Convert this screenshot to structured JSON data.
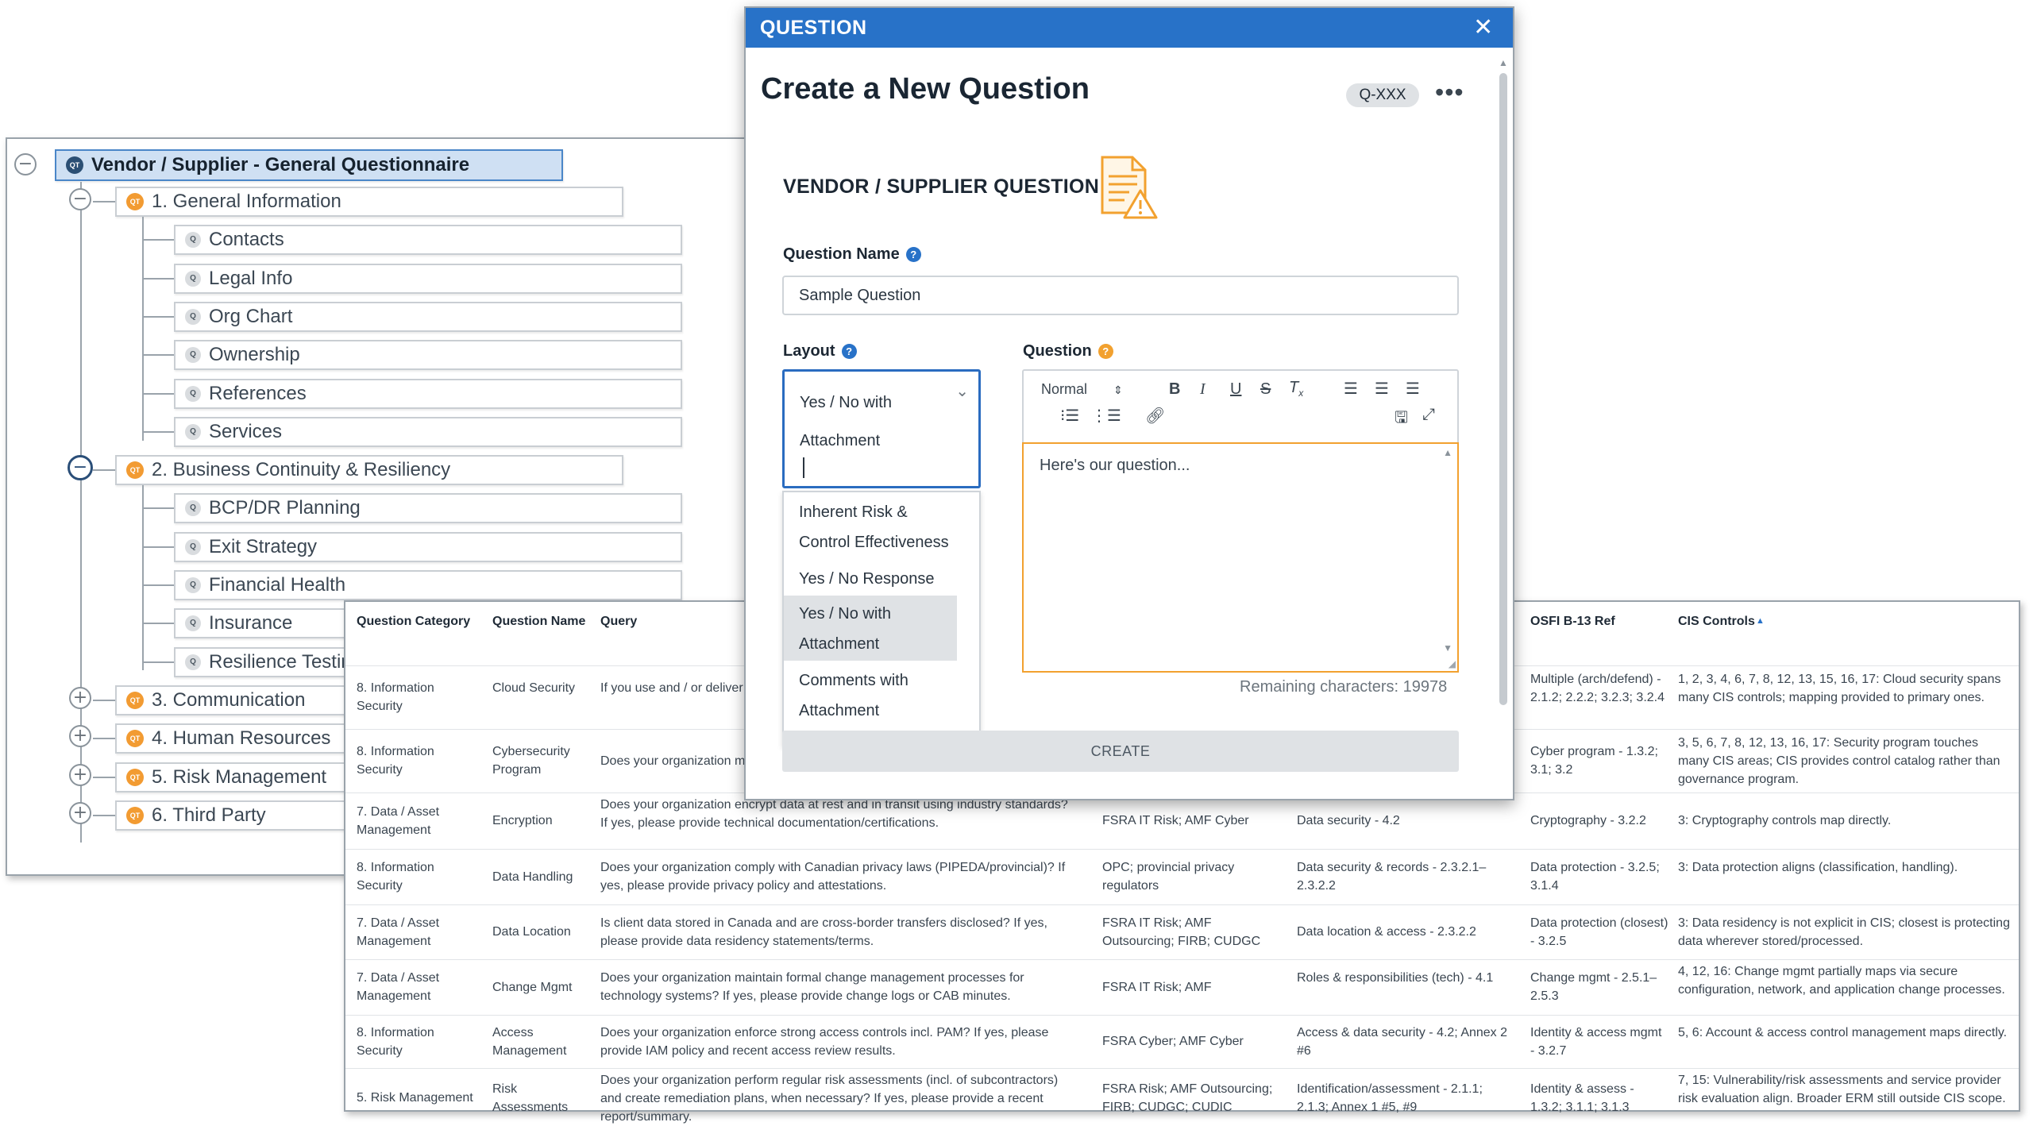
{
  "tree": {
    "root": {
      "label": "Vendor / Supplier - General Questionnaire",
      "badge": "QT"
    },
    "node_badge": "QT",
    "question_badge": "Q",
    "expand_symbol": "+",
    "collapse_symbol": "−",
    "sections": [
      {
        "label": "1. General Information",
        "expanded": true,
        "children": [
          "Contacts",
          "Legal Info",
          "Org Chart",
          "Ownership",
          "References",
          "Services"
        ]
      },
      {
        "label": "2. Business Continuity & Resiliency",
        "expanded": true,
        "children": [
          "BCP/DR Planning",
          "Exit Strategy",
          "Financial Health",
          "Insurance",
          "Resilience Testin"
        ]
      },
      {
        "label": "3. Communication",
        "expanded": false,
        "children": []
      },
      {
        "label": "4. Human Resources",
        "expanded": false,
        "children": []
      },
      {
        "label": "5. Risk Management",
        "expanded": false,
        "children": []
      },
      {
        "label": "6. Third Party",
        "expanded": false,
        "children": []
      }
    ]
  },
  "table": {
    "headers": {
      "category": "Question Category",
      "name": "Question Name",
      "query": "Query",
      "osfi": "OSFI B-13 Ref",
      "cis": "CIS Controls",
      "sort_icon": "triangle-up"
    },
    "rows": [
      {
        "category": "8. Information Security",
        "name": "Cloud Security",
        "query": "If you use and / or deliver recognized cloud security policies/certifications.",
        "reg": "",
        "ref": "",
        "osfi": "Multiple (arch/defend) - 2.1.2; 2.2.2; 3.2.3; 3.2.4",
        "cis": "1, 2, 3, 4, 6, 7, 8, 12, 13, 15, 16, 17: Cloud security spans many CIS controls; mapping provided to primary ones."
      },
      {
        "category": "8. Information Security",
        "name": "Cybersecurity Program",
        "query": "Does your organization m ISO/NIST/CIS? If yes, pleas",
        "reg": "",
        "ref": "",
        "osfi": "Cyber program - 1.3.2; 3.1; 3.2",
        "cis": "3, 5, 6, 7, 8, 12, 13, 16, 17: Security program touches many CIS areas; CIS provides control catalog rather than governance program."
      },
      {
        "category": "7. Data / Asset Management",
        "name": "Encryption",
        "query": "Does your organization encrypt data at rest and in transit using industry standards? If yes, please provide technical documentation/certifications.",
        "reg": "FSRA IT Risk; AMF Cyber",
        "ref": "Data security - 4.2",
        "osfi": "Cryptography - 3.2.2",
        "cis": "3: Cryptography controls map directly."
      },
      {
        "category": "8. Information Security",
        "name": "Data Handling",
        "query": "Does your organization comply with Canadian privacy laws (PIPEDA/provincial)? If yes, please provide privacy policy and attestations.",
        "reg": "OPC; provincial privacy regulators",
        "ref": "Data security & records - 2.3.2.1–2.3.2.2",
        "osfi": "Data protection - 3.2.5; 3.1.4",
        "cis": "3: Data protection aligns (classification, handling)."
      },
      {
        "category": "7. Data / Asset Management",
        "name": "Data Location",
        "query": "Is client data stored in Canada and are cross-border transfers disclosed? If yes, please provide data residency statements/terms.",
        "reg": "FSRA IT Risk; AMF Outsourcing; FIRB; CUDGC",
        "ref": "Data location & access - 2.3.2.2",
        "osfi": "Data protection (closest) - 3.2.5",
        "cis": "3: Data residency is not explicit in CIS; closest is protecting data wherever stored/processed."
      },
      {
        "category": "7. Data / Asset Management",
        "name": "Change Mgmt",
        "query": "Does your organization maintain formal change management processes for technology systems? If yes, please provide change logs or CAB minutes.",
        "reg": "FSRA IT Risk; AMF",
        "ref": "Roles & responsibilities (tech) - 4.1",
        "osfi": "Change mgmt - 2.5.1–2.5.3",
        "cis": "4, 12, 16: Change mgmt partially maps via secure configuration, network, and application change processes."
      },
      {
        "category": "8. Information Security",
        "name": "Access Management",
        "query": "Does your organization enforce strong access controls incl. PAM? If yes, please provide IAM policy and recent access review results.",
        "reg": "FSRA Cyber; AMF Cyber",
        "ref": "Access & data security - 4.2; Annex 2 #6",
        "osfi": "Identity & access mgmt - 3.2.7",
        "cis": "5, 6: Account & access control management maps directly."
      },
      {
        "category": "5. Risk Management",
        "name": "Risk Assessments",
        "query": "Does your organization perform regular risk assessments (incl. of subcontractors) and create remediation plans, when necessary? If yes, please provide a recent report/summary.",
        "reg": "FSRA Risk; AMF Outsourcing; FIRB; CUDGC; CUDIC",
        "ref": "Identification/assessment - 2.1.1; 2.1.3; Annex 1 #5, #9",
        "osfi": "Identity & assess - 1.3.2; 3.1.1; 3.1.3",
        "cis": "7, 15: Vulnerability/risk assessments and service provider risk evaluation align. Broader ERM still outside CIS scope."
      }
    ]
  },
  "modal": {
    "header": "QUESTION",
    "close_symbol": "✕",
    "title": "Create a New Question",
    "id_badge": "Q-XXX",
    "more_symbol": "•••",
    "section_title": "VENDOR / SUPPLIER QUESTION",
    "question_name_label": "Question Name",
    "question_name_value": "Sample Question",
    "layout_label": "Layout",
    "layout_value": "Yes / No with Attachment",
    "layout_options": [
      "Inherent Risk & Control Effectiveness",
      "Yes / No Response",
      "Yes / No with Attachment",
      "Comments with Attachment"
    ],
    "selected_option": "Yes / No with Attachment",
    "question_label": "Question",
    "editor_format": "Normal",
    "editor_text": "Here's our question...",
    "remaining": "Remaining characters: 19978",
    "create_label": "CREATE",
    "help_symbol": "?",
    "colors": {
      "header": "#2872c8",
      "accent_orange": "#f2a12f",
      "focus_blue": "#2a6cc0"
    }
  }
}
